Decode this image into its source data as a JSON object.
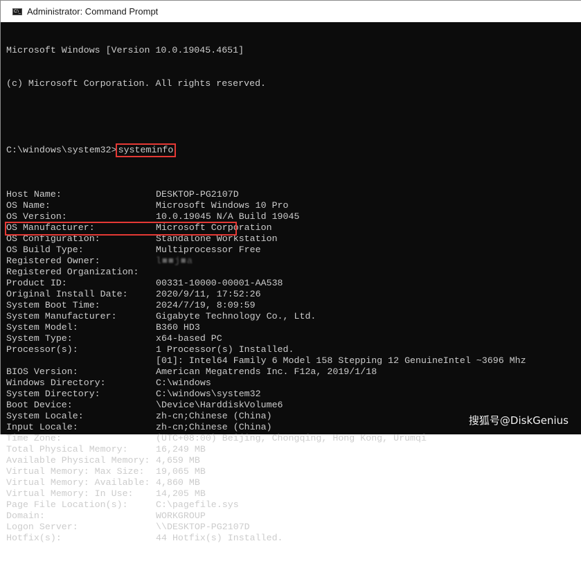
{
  "window": {
    "title": "Administrator: Command Prompt",
    "icon": "cmd-icon"
  },
  "console": {
    "banner": [
      "Microsoft Windows [Version 10.0.19045.4651]",
      "(c) Microsoft Corporation. All rights reserved."
    ],
    "prompt": "C:\\windows\\system32>",
    "command": "systeminfo",
    "rows": [
      {
        "label": "Host Name:",
        "value": "DESKTOP-PG2107D"
      },
      {
        "label": "OS Name:",
        "value": "Microsoft Windows 10 Pro"
      },
      {
        "label": "OS Version:",
        "value": "10.0.19045 N/A Build 19045"
      },
      {
        "label": "OS Manufacturer:",
        "value": "Microsoft Corporation"
      },
      {
        "label": "OS Configuration:",
        "value": "Standalone Workstation"
      },
      {
        "label": "OS Build Type:",
        "value": "Multiprocessor Free"
      },
      {
        "label": "Registered Owner:",
        "value": "l■■j■a"
      },
      {
        "label": "Registered Organization:",
        "value": ""
      },
      {
        "label": "Product ID:",
        "value": "00331-10000-00001-AA538"
      },
      {
        "label": "Original Install Date:",
        "value": "2020/9/11, 17:52:26"
      },
      {
        "label": "System Boot Time:",
        "value": "2024/7/19, 8:09:59"
      },
      {
        "label": "System Manufacturer:",
        "value": "Gigabyte Technology Co., Ltd."
      },
      {
        "label": "System Model:",
        "value": "B360 HD3"
      },
      {
        "label": "System Type:",
        "value": "x64-based PC"
      },
      {
        "label": "Processor(s):",
        "value": "1 Processor(s) Installed."
      },
      {
        "label": "",
        "value": "[01]: Intel64 Family 6 Model 158 Stepping 12 GenuineIntel ~3696 Mhz"
      },
      {
        "label": "BIOS Version:",
        "value": "American Megatrends Inc. F12a, 2019/1/18"
      },
      {
        "label": "Windows Directory:",
        "value": "C:\\windows"
      },
      {
        "label": "System Directory:",
        "value": "C:\\windows\\system32"
      },
      {
        "label": "Boot Device:",
        "value": "\\Device\\HarddiskVolume6"
      },
      {
        "label": "System Locale:",
        "value": "zh-cn;Chinese (China)"
      },
      {
        "label": "Input Locale:",
        "value": "zh-cn;Chinese (China)"
      },
      {
        "label": "Time Zone:",
        "value": "(UTC+08:00) Beijing, Chongqing, Hong Kong, Urumqi"
      },
      {
        "label": "Total Physical Memory:",
        "value": "16,249 MB"
      },
      {
        "label": "Available Physical Memory:",
        "value": "4,659 MB"
      },
      {
        "label": "Virtual Memory: Max Size:",
        "value": "19,065 MB"
      },
      {
        "label": "Virtual Memory: Available:",
        "value": "4,860 MB"
      },
      {
        "label": "Virtual Memory: In Use:",
        "value": "14,205 MB"
      },
      {
        "label": "Page File Location(s):",
        "value": "C:\\pagefile.sys"
      },
      {
        "label": "Domain:",
        "value": "WORKGROUP"
      },
      {
        "label": "Logon Server:",
        "value": "\\\\DESKTOP-PG2107D"
      },
      {
        "label": "Hotfix(s):",
        "value": "44 Hotfix(s) Installed."
      }
    ]
  },
  "annotations": {
    "highlight_color": "#e53935",
    "highlighted_command": "systeminfo",
    "highlighted_row": "System Type:"
  },
  "watermark": "搜狐号@DiskGenius",
  "colors": {
    "console_bg": "#0c0c0c",
    "console_fg": "#cccccc",
    "titlebar_bg": "#ffffff"
  }
}
